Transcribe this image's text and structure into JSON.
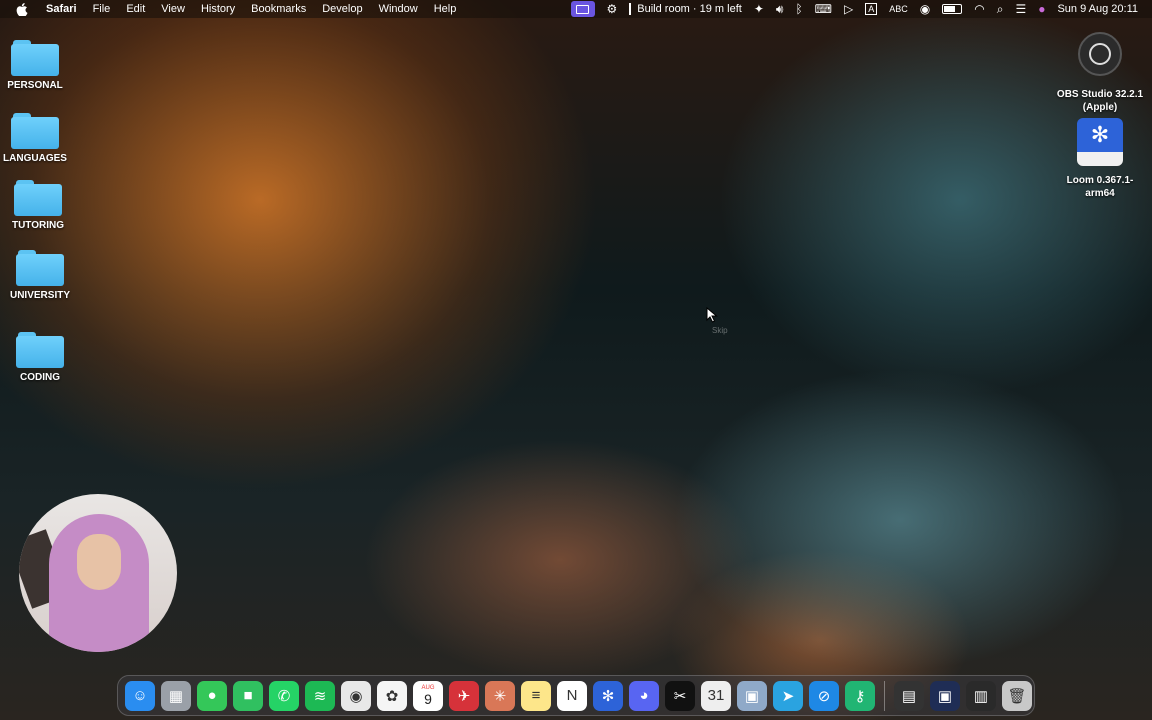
{
  "menubar": {
    "app_name": "Safari",
    "menus": [
      "File",
      "Edit",
      "View",
      "History",
      "Bookmarks",
      "Develop",
      "Window",
      "Help"
    ],
    "status": {
      "build_room": "Build room · 19 m left",
      "input_indicator": "A",
      "input_source": "ABC",
      "date_time": "Sun 9 Aug  20:11"
    }
  },
  "desktop": {
    "folders": [
      {
        "label": "PERSONAL"
      },
      {
        "label": "LANGUAGES"
      },
      {
        "label": "TUTORING"
      },
      {
        "label": "UNIVERSITY"
      },
      {
        "label": "CODING"
      }
    ],
    "apps": [
      {
        "label_line1": "OBS Studio 32.2.1",
        "label_line2": "(Apple)"
      },
      {
        "label_line1": "Loom 0.367.1-",
        "label_line2": "arm64"
      }
    ],
    "overlay_text": "Skip"
  },
  "dock": {
    "calendar_month": "AUG",
    "calendar_day": "9",
    "apps": [
      {
        "name": "Finder",
        "color": "#2a8df0",
        "glyph": "☺"
      },
      {
        "name": "Launchpad",
        "color": "#9aa0a8",
        "glyph": "▦"
      },
      {
        "name": "Messages",
        "color": "#34c759",
        "glyph": "●"
      },
      {
        "name": "FaceTime",
        "color": "#30c060",
        "glyph": "■"
      },
      {
        "name": "WhatsApp",
        "color": "#25d366",
        "glyph": "✆"
      },
      {
        "name": "Spotify",
        "color": "#1db954",
        "glyph": "≋"
      },
      {
        "name": "Chrome",
        "color": "#e8e8e8",
        "glyph": "◉"
      },
      {
        "name": "Photos",
        "color": "#f5f5f5",
        "glyph": "✿"
      },
      {
        "name": "Calendar",
        "color": "#ffffff",
        "glyph": ""
      },
      {
        "name": "Airmail",
        "color": "#d6323a",
        "glyph": "✈"
      },
      {
        "name": "Claude",
        "color": "#d97757",
        "glyph": "✳"
      },
      {
        "name": "Notes",
        "color": "#fde68a",
        "glyph": "≡"
      },
      {
        "name": "Notion",
        "color": "#ffffff",
        "glyph": "N"
      },
      {
        "name": "Loom",
        "color": "#2d63d8",
        "glyph": "✻"
      },
      {
        "name": "Discord",
        "color": "#5865f2",
        "glyph": "◕"
      },
      {
        "name": "CapCut",
        "color": "#111111",
        "glyph": "✂"
      },
      {
        "name": "Calendar 31",
        "color": "#eeeeee",
        "glyph": "31"
      },
      {
        "name": "Preview",
        "color": "#8fa9c8",
        "glyph": "▣"
      },
      {
        "name": "Telegram",
        "color": "#2aa3e0",
        "glyph": "➤"
      },
      {
        "name": "Safari",
        "color": "#1e88e5",
        "glyph": "⊘"
      },
      {
        "name": "Passwords",
        "color": "#21b573",
        "glyph": "⚷"
      }
    ],
    "recents": [
      {
        "name": "Recent window 1",
        "color": "#333333",
        "glyph": "▤"
      },
      {
        "name": "Recent window 2",
        "color": "#1f2d55",
        "glyph": "▣"
      },
      {
        "name": "Recent window 3",
        "color": "#2a2a2a",
        "glyph": "▥"
      },
      {
        "name": "Trash",
        "color": "#c8c8c8",
        "glyph": "🗑"
      }
    ]
  }
}
